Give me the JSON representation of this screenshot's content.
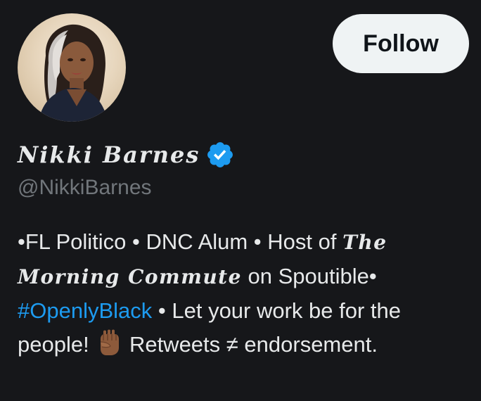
{
  "profile": {
    "display_name": "𝑵𝒊𝒌𝒌𝒊 𝑩𝒂𝒓𝒏𝒆𝒔",
    "handle": "@NikkiBarnes",
    "follow_label": "Follow",
    "verified": true,
    "avatar_icon": "profile-photo",
    "verified_icon": "verified-badge-icon",
    "bio": {
      "part1": "•FL Politico • DNC Alum • Host of ",
      "show_name": "𝑻𝒉𝒆 𝑴𝒐𝒓𝒏𝒊𝒏𝒈 𝑪𝒐𝒎𝒎𝒖𝒕𝒆",
      "part2": " on Spoutible• ",
      "hashtag": "#OpenlyBlack",
      "part3": " • Let your work be for the people! ",
      "emoji_icon": "raised-fist-icon",
      "part4": " Retweets ≠ endorsement."
    }
  },
  "colors": {
    "background": "#16171a",
    "text": "#e7e9ea",
    "handle": "#71767b",
    "link": "#1d9bf0",
    "verified": "#1d9bf0",
    "button_bg": "#eff3f4",
    "button_text": "#0f1419"
  }
}
